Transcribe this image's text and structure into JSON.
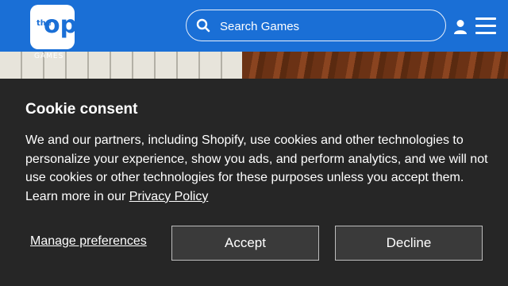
{
  "header": {
    "logo_word": "the",
    "logo_mark": "op",
    "logo_subtitle": "GAMES",
    "search_placeholder": "Search Games",
    "icons": [
      "search-icon",
      "user-icon",
      "menu-icon"
    ],
    "brand_color": "#1a6fd6"
  },
  "consent": {
    "title": "Cookie consent",
    "body": "We and our partners, including Shopify, use cookies and other technologies to personalize your experience, show you ads, and perform analytics, and we will not use cookies or other technologies for these purposes unless you accept them. Learn more in our ",
    "privacy_link": "Privacy Policy",
    "manage_label": "Manage preferences",
    "accept_label": "Accept",
    "decline_label": "Decline",
    "background_color": "#262626"
  }
}
